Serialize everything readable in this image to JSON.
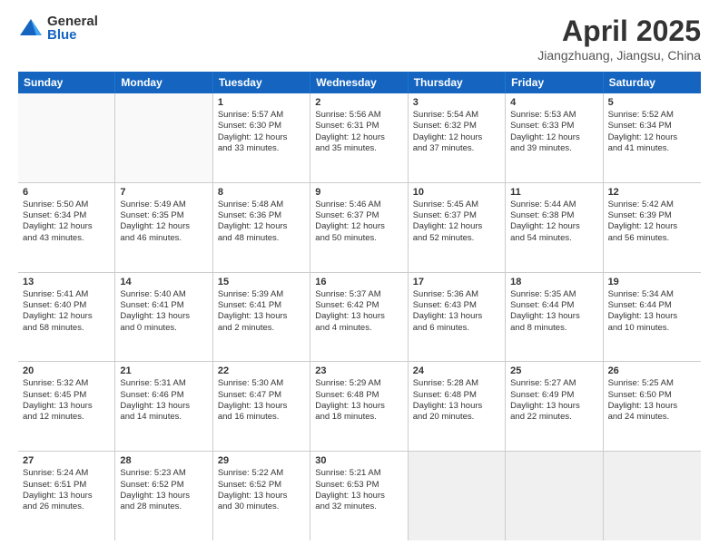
{
  "logo": {
    "general": "General",
    "blue": "Blue"
  },
  "title": "April 2025",
  "subtitle": "Jiangzhuang, Jiangsu, China",
  "headers": [
    "Sunday",
    "Monday",
    "Tuesday",
    "Wednesday",
    "Thursday",
    "Friday",
    "Saturday"
  ],
  "weeks": [
    [
      {
        "day": "",
        "empty": true
      },
      {
        "day": "",
        "empty": true
      },
      {
        "day": "1",
        "lines": [
          "Sunrise: 5:57 AM",
          "Sunset: 6:30 PM",
          "Daylight: 12 hours",
          "and 33 minutes."
        ]
      },
      {
        "day": "2",
        "lines": [
          "Sunrise: 5:56 AM",
          "Sunset: 6:31 PM",
          "Daylight: 12 hours",
          "and 35 minutes."
        ]
      },
      {
        "day": "3",
        "lines": [
          "Sunrise: 5:54 AM",
          "Sunset: 6:32 PM",
          "Daylight: 12 hours",
          "and 37 minutes."
        ]
      },
      {
        "day": "4",
        "lines": [
          "Sunrise: 5:53 AM",
          "Sunset: 6:33 PM",
          "Daylight: 12 hours",
          "and 39 minutes."
        ]
      },
      {
        "day": "5",
        "lines": [
          "Sunrise: 5:52 AM",
          "Sunset: 6:34 PM",
          "Daylight: 12 hours",
          "and 41 minutes."
        ]
      }
    ],
    [
      {
        "day": "6",
        "lines": [
          "Sunrise: 5:50 AM",
          "Sunset: 6:34 PM",
          "Daylight: 12 hours",
          "and 43 minutes."
        ]
      },
      {
        "day": "7",
        "lines": [
          "Sunrise: 5:49 AM",
          "Sunset: 6:35 PM",
          "Daylight: 12 hours",
          "and 46 minutes."
        ]
      },
      {
        "day": "8",
        "lines": [
          "Sunrise: 5:48 AM",
          "Sunset: 6:36 PM",
          "Daylight: 12 hours",
          "and 48 minutes."
        ]
      },
      {
        "day": "9",
        "lines": [
          "Sunrise: 5:46 AM",
          "Sunset: 6:37 PM",
          "Daylight: 12 hours",
          "and 50 minutes."
        ]
      },
      {
        "day": "10",
        "lines": [
          "Sunrise: 5:45 AM",
          "Sunset: 6:37 PM",
          "Daylight: 12 hours",
          "and 52 minutes."
        ]
      },
      {
        "day": "11",
        "lines": [
          "Sunrise: 5:44 AM",
          "Sunset: 6:38 PM",
          "Daylight: 12 hours",
          "and 54 minutes."
        ]
      },
      {
        "day": "12",
        "lines": [
          "Sunrise: 5:42 AM",
          "Sunset: 6:39 PM",
          "Daylight: 12 hours",
          "and 56 minutes."
        ]
      }
    ],
    [
      {
        "day": "13",
        "lines": [
          "Sunrise: 5:41 AM",
          "Sunset: 6:40 PM",
          "Daylight: 12 hours",
          "and 58 minutes."
        ]
      },
      {
        "day": "14",
        "lines": [
          "Sunrise: 5:40 AM",
          "Sunset: 6:41 PM",
          "Daylight: 13 hours",
          "and 0 minutes."
        ]
      },
      {
        "day": "15",
        "lines": [
          "Sunrise: 5:39 AM",
          "Sunset: 6:41 PM",
          "Daylight: 13 hours",
          "and 2 minutes."
        ]
      },
      {
        "day": "16",
        "lines": [
          "Sunrise: 5:37 AM",
          "Sunset: 6:42 PM",
          "Daylight: 13 hours",
          "and 4 minutes."
        ]
      },
      {
        "day": "17",
        "lines": [
          "Sunrise: 5:36 AM",
          "Sunset: 6:43 PM",
          "Daylight: 13 hours",
          "and 6 minutes."
        ]
      },
      {
        "day": "18",
        "lines": [
          "Sunrise: 5:35 AM",
          "Sunset: 6:44 PM",
          "Daylight: 13 hours",
          "and 8 minutes."
        ]
      },
      {
        "day": "19",
        "lines": [
          "Sunrise: 5:34 AM",
          "Sunset: 6:44 PM",
          "Daylight: 13 hours",
          "and 10 minutes."
        ]
      }
    ],
    [
      {
        "day": "20",
        "lines": [
          "Sunrise: 5:32 AM",
          "Sunset: 6:45 PM",
          "Daylight: 13 hours",
          "and 12 minutes."
        ]
      },
      {
        "day": "21",
        "lines": [
          "Sunrise: 5:31 AM",
          "Sunset: 6:46 PM",
          "Daylight: 13 hours",
          "and 14 minutes."
        ]
      },
      {
        "day": "22",
        "lines": [
          "Sunrise: 5:30 AM",
          "Sunset: 6:47 PM",
          "Daylight: 13 hours",
          "and 16 minutes."
        ]
      },
      {
        "day": "23",
        "lines": [
          "Sunrise: 5:29 AM",
          "Sunset: 6:48 PM",
          "Daylight: 13 hours",
          "and 18 minutes."
        ]
      },
      {
        "day": "24",
        "lines": [
          "Sunrise: 5:28 AM",
          "Sunset: 6:48 PM",
          "Daylight: 13 hours",
          "and 20 minutes."
        ]
      },
      {
        "day": "25",
        "lines": [
          "Sunrise: 5:27 AM",
          "Sunset: 6:49 PM",
          "Daylight: 13 hours",
          "and 22 minutes."
        ]
      },
      {
        "day": "26",
        "lines": [
          "Sunrise: 5:25 AM",
          "Sunset: 6:50 PM",
          "Daylight: 13 hours",
          "and 24 minutes."
        ]
      }
    ],
    [
      {
        "day": "27",
        "lines": [
          "Sunrise: 5:24 AM",
          "Sunset: 6:51 PM",
          "Daylight: 13 hours",
          "and 26 minutes."
        ]
      },
      {
        "day": "28",
        "lines": [
          "Sunrise: 5:23 AM",
          "Sunset: 6:52 PM",
          "Daylight: 13 hours",
          "and 28 minutes."
        ]
      },
      {
        "day": "29",
        "lines": [
          "Sunrise: 5:22 AM",
          "Sunset: 6:52 PM",
          "Daylight: 13 hours",
          "and 30 minutes."
        ]
      },
      {
        "day": "30",
        "lines": [
          "Sunrise: 5:21 AM",
          "Sunset: 6:53 PM",
          "Daylight: 13 hours",
          "and 32 minutes."
        ]
      },
      {
        "day": "",
        "empty": true,
        "shaded": true
      },
      {
        "day": "",
        "empty": true,
        "shaded": true
      },
      {
        "day": "",
        "empty": true,
        "shaded": true
      }
    ]
  ]
}
